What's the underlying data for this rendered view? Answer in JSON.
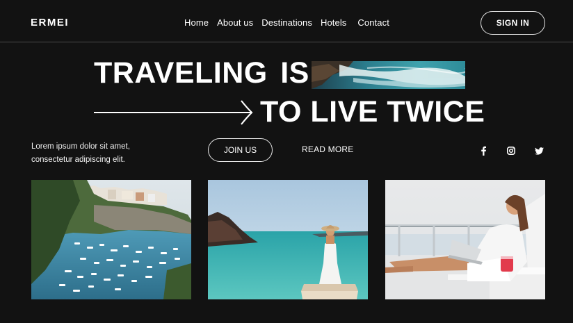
{
  "header": {
    "logo": "ERMEI",
    "nav": [
      "Home",
      "About us",
      "Destinations",
      "Hotels",
      "Contact"
    ],
    "signin_label": "SIGN IN"
  },
  "hero": {
    "line1": "TRAVELING IS",
    "line2": "TO LIVE TWICE",
    "arrow_icon": "long-arrow-right-icon"
  },
  "intro": {
    "line1": "Lorem ipsum dolor sit amet,",
    "line2": "consectetur adipiscing elit."
  },
  "actions": {
    "join_label": "JOIN US",
    "read_more_label": "READ MORE"
  },
  "social": [
    "facebook-icon",
    "instagram-icon",
    "twitter-icon"
  ],
  "gallery": [
    "coastal-harbor-photo",
    "pier-woman-photo",
    "laptop-lounger-photo"
  ],
  "colors": {
    "background": "#121212",
    "text": "#ffffff",
    "border": "#e6e6e6"
  }
}
